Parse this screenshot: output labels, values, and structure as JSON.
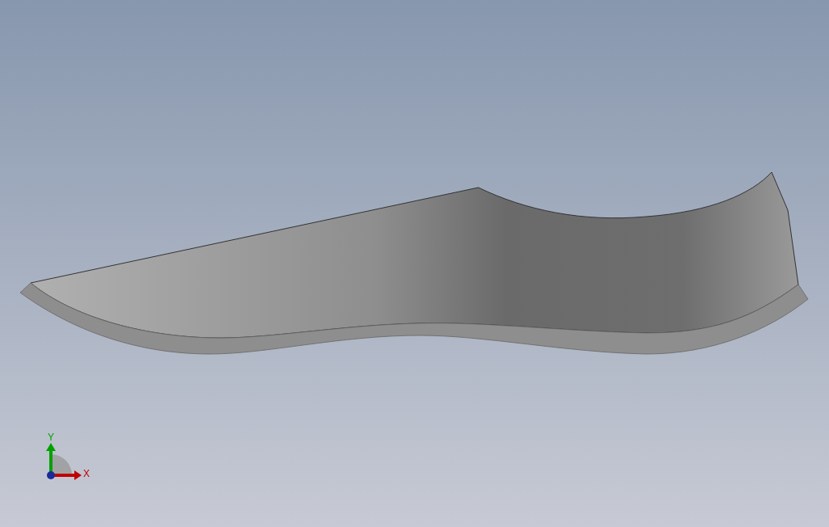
{
  "axes": [
    {
      "label": "Y",
      "color": "#00a000"
    },
    {
      "label": "X",
      "color": "#c00000"
    }
  ]
}
